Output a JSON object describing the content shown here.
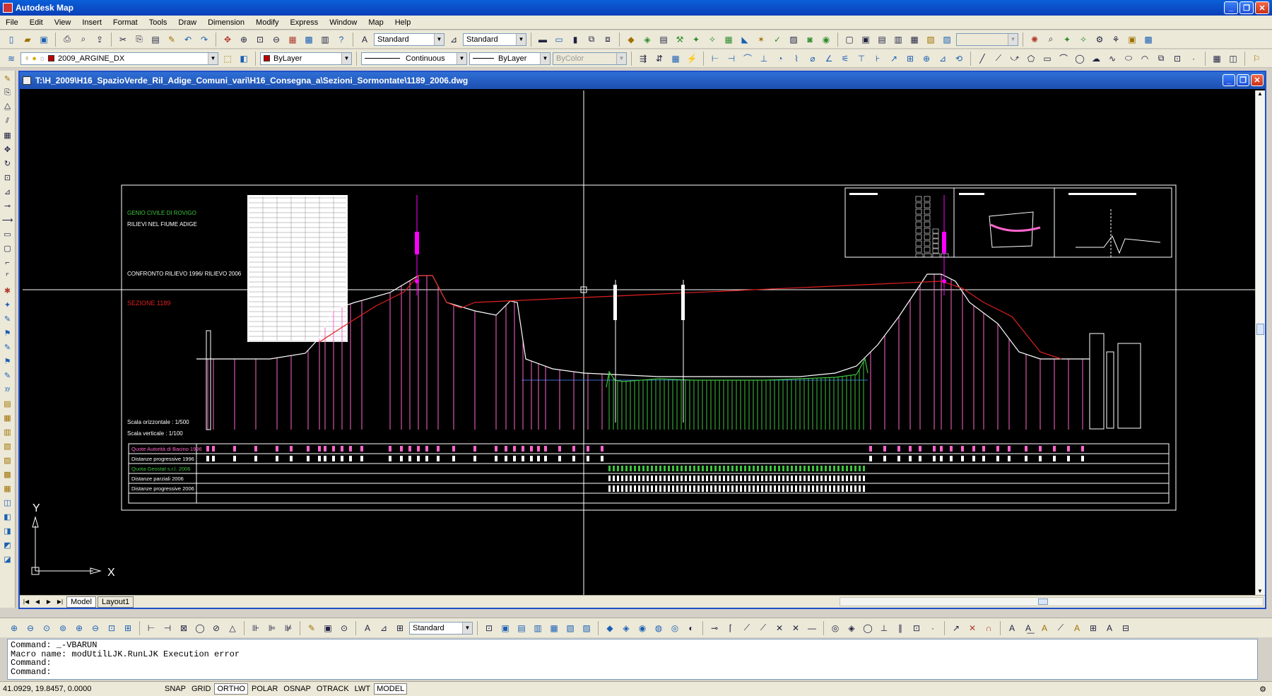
{
  "app": {
    "title": "Autodesk Map"
  },
  "menu": [
    "File",
    "Edit",
    "View",
    "Insert",
    "Format",
    "Tools",
    "Draw",
    "Dimension",
    "Modify",
    "Express",
    "Window",
    "Map",
    "Help"
  ],
  "toolbar": {
    "text_style": "Standard",
    "dim_style": "Standard",
    "layer": "2009_ARGINE_DX",
    "color": "ByLayer",
    "linetype": "Continuous",
    "lineweight": "ByLayer",
    "plotstyle": "ByColor",
    "dimstyle_bottom": "Standard"
  },
  "document": {
    "path": "T:\\H_2009\\H16_SpazioVerde_Ril_Adige_Comuni_vari\\H16_Consegna_a\\Sezioni_Sormontate\\1189_2006.dwg",
    "tabs": [
      "Model",
      "Layout1"
    ]
  },
  "drawing": {
    "header_green": "GENIO CIVILE DI ROVIGO",
    "header_white": "RILIEVI NEL FIUME ADIGE",
    "compare": "CONFRONTO RILIEVO 1996/ RILIEVO 2006",
    "section": "SEZIONE 1189",
    "scale_h": "Scala orizzontale : 1/500",
    "scale_v": "Scala verticale : 1/100",
    "rows": [
      "Quote Autorità di Bacino 1996",
      "Distanze progressive 1996",
      "Quota Geostat s.r.l. 2006",
      "Distanze parziali 2006",
      "Distanze progressive 2006"
    ],
    "ucs_x": "X",
    "ucs_y": "Y",
    "colors": {
      "green": "#3ec43e",
      "pink": "#ff66cc",
      "red": "#e02020",
      "white": "#ffffff",
      "blue": "#3a6ad6",
      "magenta": "#ff00ff"
    }
  },
  "command": {
    "lines": [
      "Command: _-VBARUN",
      "Macro name: modUtilLJK.RunLJK Execution error",
      "Command:",
      "Command:"
    ]
  },
  "status": {
    "coords": "41.0929, 19.8457, 0.0000",
    "buttons": [
      "SNAP",
      "GRID",
      "ORTHO",
      "POLAR",
      "OSNAP",
      "OTRACK",
      "LWT",
      "MODEL"
    ]
  }
}
